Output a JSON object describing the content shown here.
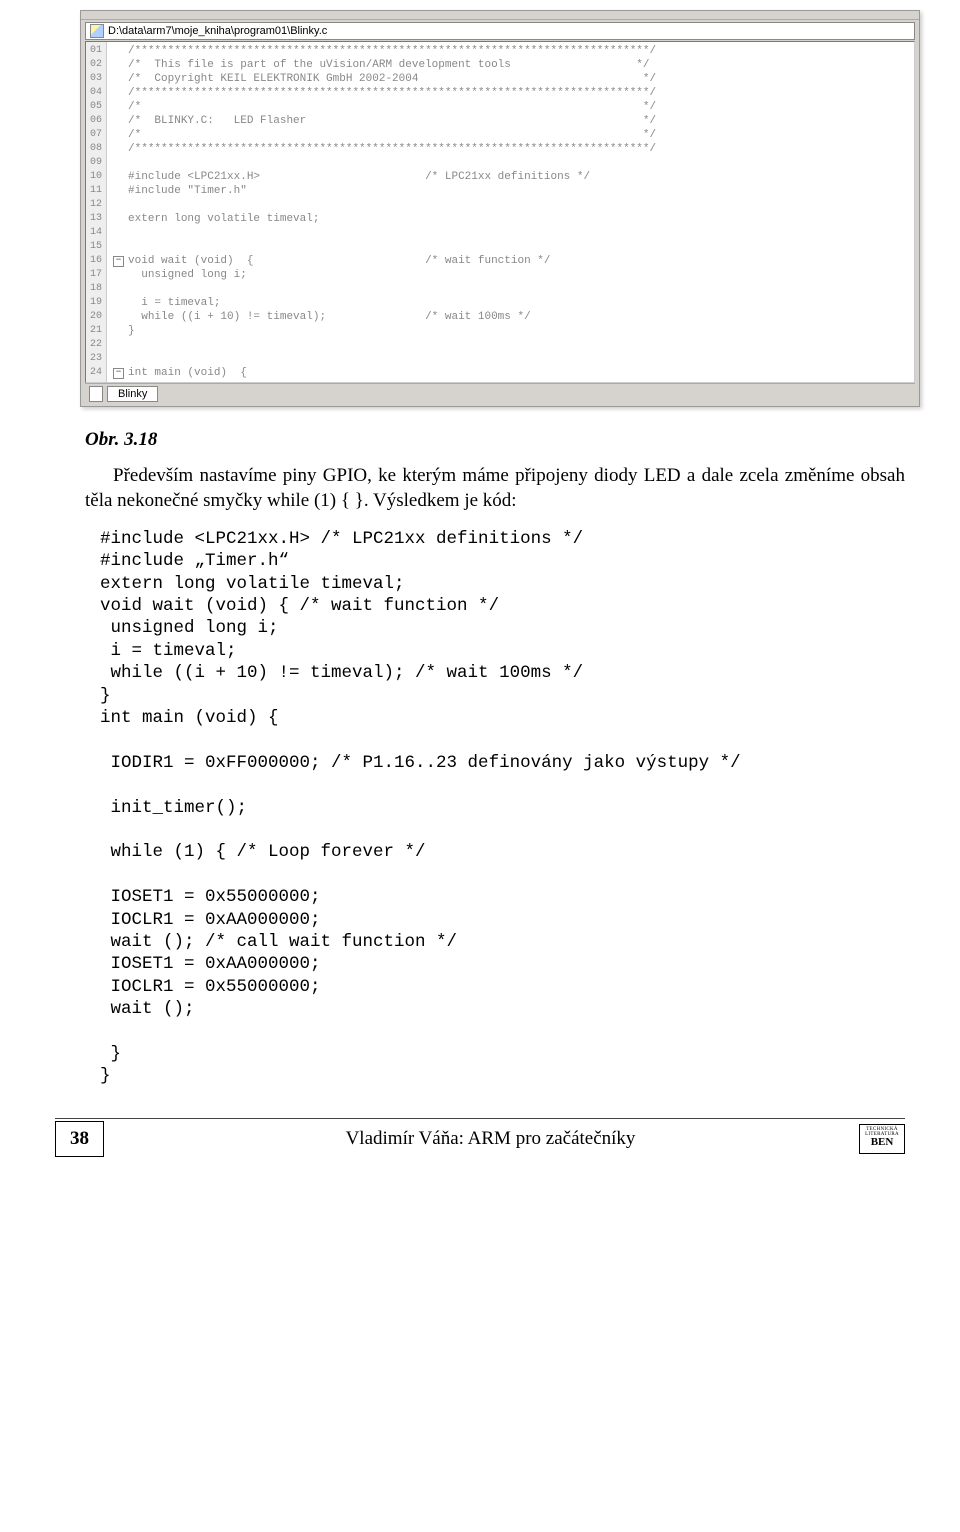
{
  "ide": {
    "file_path": "D:\\data\\arm7\\moje_kniha\\program01\\Blinky.c",
    "bottom_tab": "Blinky",
    "lines": [
      "/******************************************************************************/",
      "/*  This file is part of the uVision/ARM development tools                   */",
      "/*  Copyright KEIL ELEKTRONIK GmbH 2002-2004                                  */",
      "/******************************************************************************/",
      "/*                                                                            */",
      "/*  BLINKY.C:   LED Flasher                                                   */",
      "/*                                                                            */",
      "/******************************************************************************/",
      "",
      "#include <LPC21xx.H>                         /* LPC21xx definitions */",
      "#include \"Timer.h\"",
      "",
      "extern long volatile timeval;",
      "",
      "",
      "void wait (void)  {                          /* wait function */",
      "  unsigned long i;",
      "",
      "  i = timeval;",
      "  while ((i + 10) != timeval);               /* wait 100ms */",
      "}",
      "",
      "",
      "int main (void)  {"
    ]
  },
  "caption": "Obr. 3.18",
  "paragraph": "Především nastavíme piny GPIO, ke kterým máme připojeny diody LED a dale zcela změníme obsah těla nekonečné smyčky while (1) { }. Výsledkem je kód:",
  "listing": "#include <LPC21xx.H> /* LPC21xx definitions */\n#include „Timer.h“\nextern long volatile timeval;\nvoid wait (void) { /* wait function */\n unsigned long i;\n i = timeval;\n while ((i + 10) != timeval); /* wait 100ms */\n}\nint main (void) {\n\n IODIR1 = 0xFF000000; /* P1.16..23 definovány jako výstupy */\n\n init_timer();\n\n while (1) { /* Loop forever */\n\n IOSET1 = 0x55000000;\n IOCLR1 = 0xAA000000;\n wait (); /* call wait function */\n IOSET1 = 0xAA000000;\n IOCLR1 = 0x55000000;\n wait ();\n\n }\n}",
  "footer": {
    "page": "38",
    "title": "Vladimír Váňa: ARM pro začátečníky",
    "publisher_top": "TECHNICKÁ LITERATURA",
    "publisher": "BEN"
  }
}
